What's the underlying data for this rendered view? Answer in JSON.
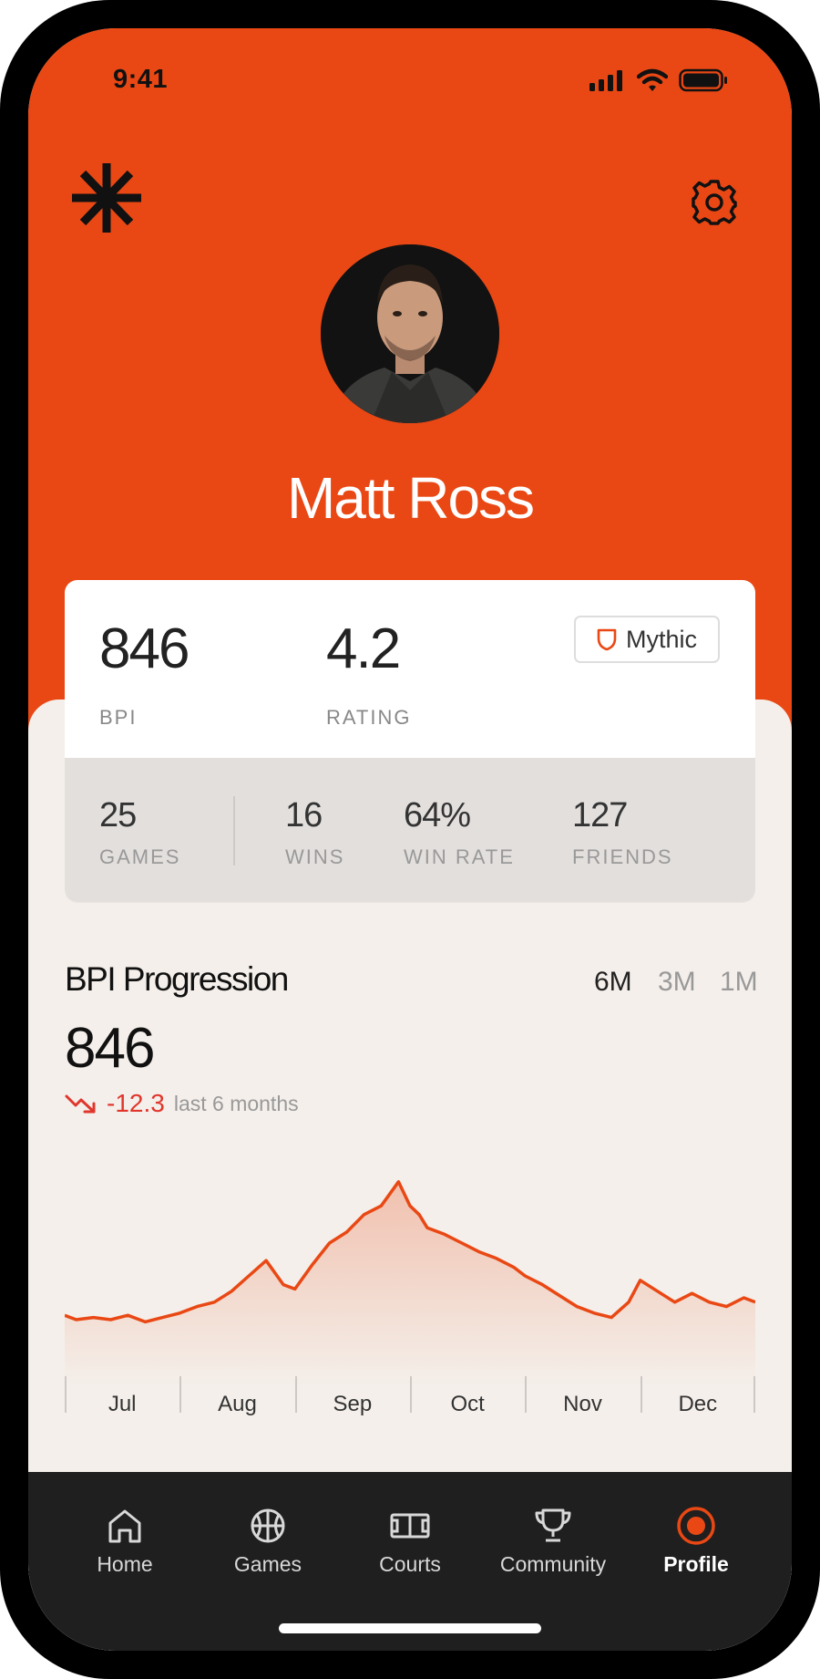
{
  "status": {
    "time": "9:41"
  },
  "colors": {
    "accent": "#e94814",
    "negative": "#e0362c",
    "background": "#f4efea",
    "tabbar": "#1f1f1f"
  },
  "header": {
    "logo_icon": "asterisk-logo-icon",
    "settings_icon": "gear-icon"
  },
  "profile": {
    "name": "Matt Ross",
    "avatar": "profile-photo"
  },
  "stats": {
    "bpi": {
      "value": "846",
      "label": "BPI"
    },
    "rating": {
      "value": "4.2",
      "label": "RATING"
    },
    "badge": {
      "label": "Mythic",
      "icon": "shield-icon"
    },
    "games": {
      "value": "25",
      "label": "GAMES"
    },
    "wins": {
      "value": "16",
      "label": "WINS"
    },
    "win_rate": {
      "value": "64%",
      "label": "WIN RATE"
    },
    "friends": {
      "value": "127",
      "label": "FRIENDS"
    }
  },
  "progression": {
    "title": "BPI Progression",
    "ranges": [
      "6M",
      "3M",
      "1M"
    ],
    "active_range": "6M",
    "value": "846",
    "change": "-12.3",
    "change_note": "last 6 months",
    "trend_icon": "trend-down-icon"
  },
  "chart_data": {
    "type": "area",
    "title": "",
    "xlabel": "",
    "ylabel": "",
    "categories": [
      "Jul",
      "Aug",
      "Sep",
      "Oct",
      "Nov",
      "Dec"
    ],
    "x": [
      0,
      0.1,
      0.25,
      0.4,
      0.55,
      0.7,
      0.85,
      1,
      1.15,
      1.3,
      1.45,
      1.6,
      1.75,
      1.9,
      2,
      2.15,
      2.3,
      2.45,
      2.6,
      2.75,
      2.9,
      3,
      3.08,
      3.15,
      3.3,
      3.45,
      3.6,
      3.75,
      3.9,
      4,
      4.15,
      4.3,
      4.45,
      4.6,
      4.75,
      4.9,
      5,
      5.15,
      5.3,
      5.45,
      5.6,
      5.75,
      5.9,
      6
    ],
    "y": [
      812,
      810,
      811,
      810,
      812,
      809,
      811,
      813,
      816,
      818,
      823,
      830,
      837,
      826,
      824,
      835,
      845,
      850,
      858,
      862,
      873,
      862,
      858,
      852,
      849,
      845,
      841,
      838,
      834,
      830,
      826,
      821,
      816,
      813,
      811,
      818,
      828,
      823,
      818,
      822,
      818,
      816,
      820,
      818
    ],
    "ylim": [
      780,
      880
    ],
    "grid": false,
    "legend": "none"
  },
  "tabs": [
    {
      "label": "Home",
      "icon": "home-icon"
    },
    {
      "label": "Games",
      "icon": "basketball-icon"
    },
    {
      "label": "Courts",
      "icon": "court-icon"
    },
    {
      "label": "Community",
      "icon": "trophy-icon"
    },
    {
      "label": "Profile",
      "icon": "profile-icon"
    }
  ],
  "active_tab": "Profile"
}
